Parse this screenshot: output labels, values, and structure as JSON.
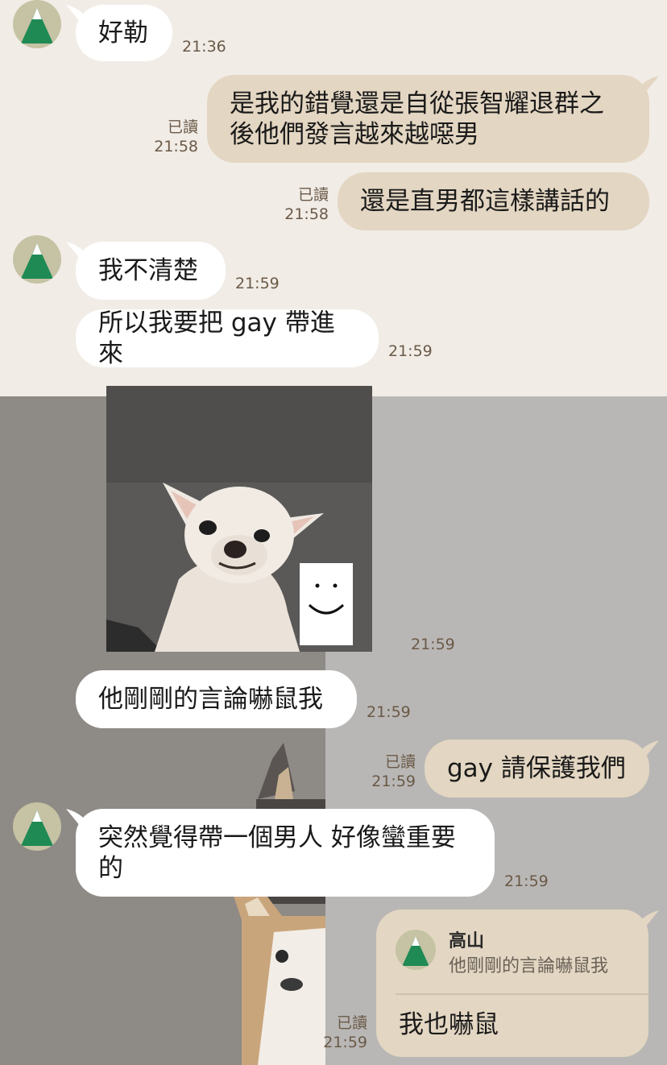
{
  "sender": {
    "name": "高山",
    "avatar": "mountain-avatar"
  },
  "colors": {
    "incoming": "#ffffff",
    "outgoing": "#e3d6c2",
    "time": "#6a5a48",
    "background": "#f1ece6",
    "avatar_green": "#1f8a54"
  },
  "messages": [
    {
      "text": "好勒",
      "time": "21:36"
    },
    {
      "line1": "是我的錯覺還是自從張智耀退群之",
      "line2": "後他們發言越來越噁男",
      "read": "已讀",
      "time": "21:58"
    },
    {
      "text": "還是直男都這樣講話的",
      "read": "已讀",
      "time": "21:58"
    },
    {
      "text": "我不清楚",
      "time": "21:59"
    },
    {
      "text": "所以我要把 gay 帶進來",
      "time": "21:59"
    },
    {
      "image": "chihuahua-smile-photo",
      "time": "21:59"
    },
    {
      "text": "他剛剛的言論嚇鼠我",
      "time": "21:59"
    },
    {
      "text": "gay 請保護我們",
      "read": "已讀",
      "time": "21:59"
    },
    {
      "line1": "突然覺得帶一個男人 好像蠻重要",
      "line2": "的",
      "time": "21:59"
    },
    {
      "reply_name": "高山",
      "reply_quote": "他剛剛的言論嚇鼠我",
      "text": "我也嚇鼠",
      "read": "已讀",
      "time": "21:59"
    }
  ]
}
